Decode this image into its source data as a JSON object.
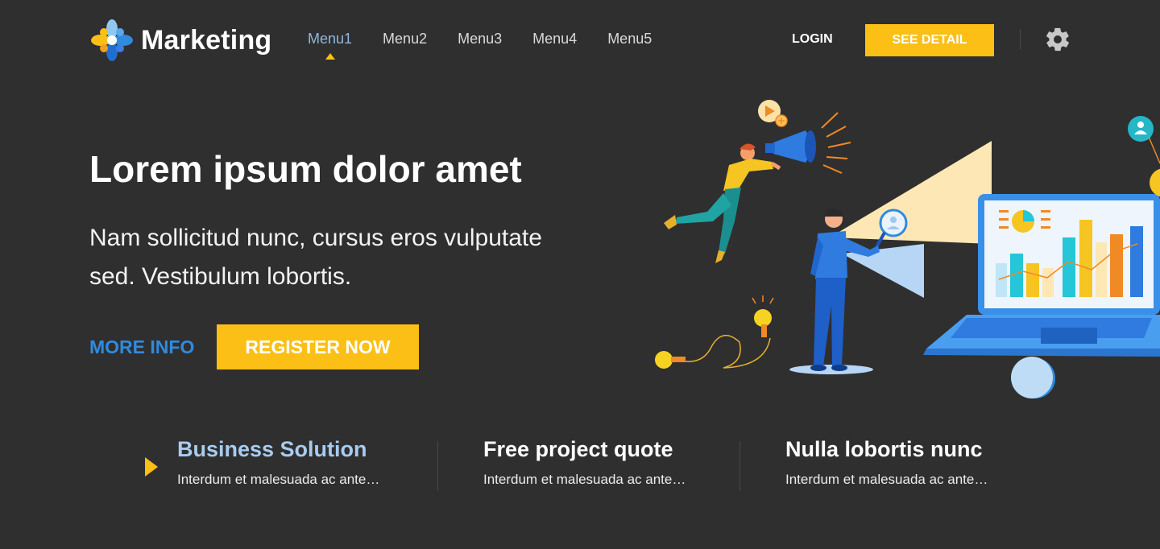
{
  "brand": {
    "name": "Marketing",
    "logo_icon": "flower-logo-icon"
  },
  "nav": {
    "menu": [
      {
        "label": "Menu1",
        "active": true
      },
      {
        "label": "Menu2",
        "active": false
      },
      {
        "label": "Menu3",
        "active": false
      },
      {
        "label": "Menu4",
        "active": false
      },
      {
        "label": "Menu5",
        "active": false
      }
    ],
    "login_label": "LOGIN",
    "see_detail_label": "SEE DETAIL",
    "settings_icon": "gear-icon"
  },
  "hero": {
    "title": "Lorem ipsum dolor amet",
    "subtitle": "Nam sollicitud nunc, cursus eros vulputate sed. Vestibulum lobortis.",
    "more_info_label": "MORE INFO",
    "register_label": "REGISTER NOW"
  },
  "features": [
    {
      "title": "Business Solution",
      "desc": "Interdum et malesuada ac ante…",
      "active": true
    },
    {
      "title": "Free project quote",
      "desc": "Interdum et malesuada ac ante…",
      "active": false
    },
    {
      "title": "Nulla lobortis nunc",
      "desc": "Interdum et malesuada ac ante…",
      "active": false
    }
  ],
  "colors": {
    "background": "#2f2f2f",
    "accent_yellow": "#fbbf16",
    "accent_blue": "#2f8bde",
    "active_menu": "#8fb8dd",
    "active_feature": "#a8ccf0"
  }
}
